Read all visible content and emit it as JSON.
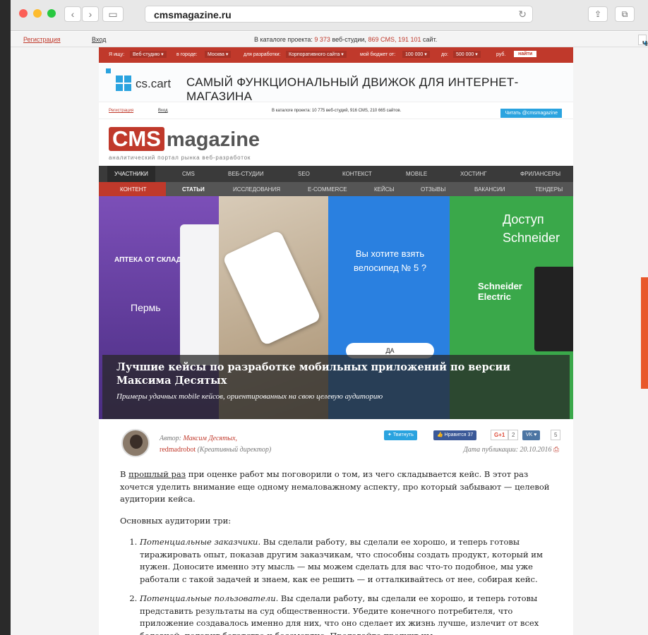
{
  "browser": {
    "url": "cmsmagazine.ru"
  },
  "topbar": {
    "register": "Регистрация",
    "login": "Вход",
    "catalog_prefix": "В каталоге проекта:",
    "studios": "9 373",
    "studios_label": "веб-студии,",
    "cms": "869 CMS,",
    "sites": "191 101",
    "sites_label": "сайт.",
    "twitter": "Читать @cmsmagazine"
  },
  "search": {
    "find": "Я ищу:",
    "what": "Веб-студию ▾",
    "city_label": "в городе:",
    "city": "Москва ▾",
    "dev_label": "для разработки:",
    "dev": "Корпоративного сайта ▾",
    "budget_label": "мой бюджет от:",
    "budget_from": "100 000 ▾",
    "to_label": "до:",
    "budget_to": "500 000 ▾",
    "currency": "руб.",
    "go": "найти"
  },
  "banner": {
    "brand": "cs.cart",
    "slogan": "САМЫЙ ФУНКЦИОНАЛЬНЫЙ ДВИЖОК ДЛЯ ИНТЕРНЕТ-МАГАЗИНА"
  },
  "strip2": {
    "register": "Регистрация",
    "login": "Вход",
    "catalog": "В каталоге проекта: 10 775 веб-студий, 916 CMS, 210 665 сайтов.",
    "twitter": "Читать @cmsmagazine"
  },
  "logo": {
    "cms": "CMS",
    "magazine": "magazine",
    "tagline": "аналитический портал рынка веб-разработок"
  },
  "nav1": [
    "УЧАСТНИКИ",
    "CMS",
    "ВЕБ-СТУДИИ",
    "SEO",
    "КОНТЕКСТ",
    "MOBILE",
    "ХОСТИНГ",
    "ФРИЛАНСЕРЫ"
  ],
  "nav2": [
    "КОНТЕНТ",
    "СТАТЬИ",
    "ИССЛЕДОВАНИЯ",
    "E-COMMERCE",
    "КЕЙСЫ",
    "ОТЗЫВЫ",
    "ВАКАНСИИ",
    "ТЕНДЕРЫ"
  ],
  "hero": {
    "title": "Лучшие кейсы по разработке мобильных приложений по версии Максима Десятых",
    "subtitle": "Примеры удачных mobile кейсов, ориентированных на свою целевую аудиторию",
    "app1": "АПТЕКА ОТ СКЛАДА",
    "app1_city": "Пермь",
    "app3_q": "Вы хотите взять велосипед № 5 ?",
    "app3_btn": "ДА",
    "app4_title": "Доступ Schneider",
    "app4_logo": "Schneider Electric"
  },
  "meta": {
    "author_label": "Автор:",
    "author": "Максим Десятых,",
    "company": "redmadrobot",
    "role": "(Креативный директор)",
    "tweet": "Твитнуть",
    "like": "Нравится 37",
    "gplus": "G+1",
    "gplus_count": "2",
    "vk": "VK",
    "vk_count": "5",
    "date_label": "Дата публикации:",
    "date": "20.10.2016"
  },
  "article": {
    "p1_link": "прошлый раз",
    "p1_before": "В",
    "p1_after": "при оценке работ мы поговорили о том, из чего складывается кейс. В этот раз хочется уделить внимание еще одному немаловажному аспекту, про который забывают — целевой аудитории кейса.",
    "p2": "Основных аудитории три:",
    "li1_em": "Потенциальные заказчики.",
    "li1": "Вы сделали работу, вы сделали ее хорошо, и теперь готовы тиражировать опыт, показав другим заказчикам, что способны создать продукт, который им нужен. Доносите именно эту мысль — мы можем сделать для вас что-то подобное, мы уже работали с такой задачей и знаем, как ее решить — и отталкивайтесь от нее, собирая кейс.",
    "li2_em": "Потенциальные пользователи.",
    "li2": "Вы сделали работу, вы сделали ее хорошо, и теперь готовы представить результаты на суд общественности. Убедите конечного потребителя, что приложение создавалось именно для них, что оно сделает их жизнь лучше, излечит от всех болезней, подарит богатство и бессмертие. Продавайте продукт им."
  }
}
